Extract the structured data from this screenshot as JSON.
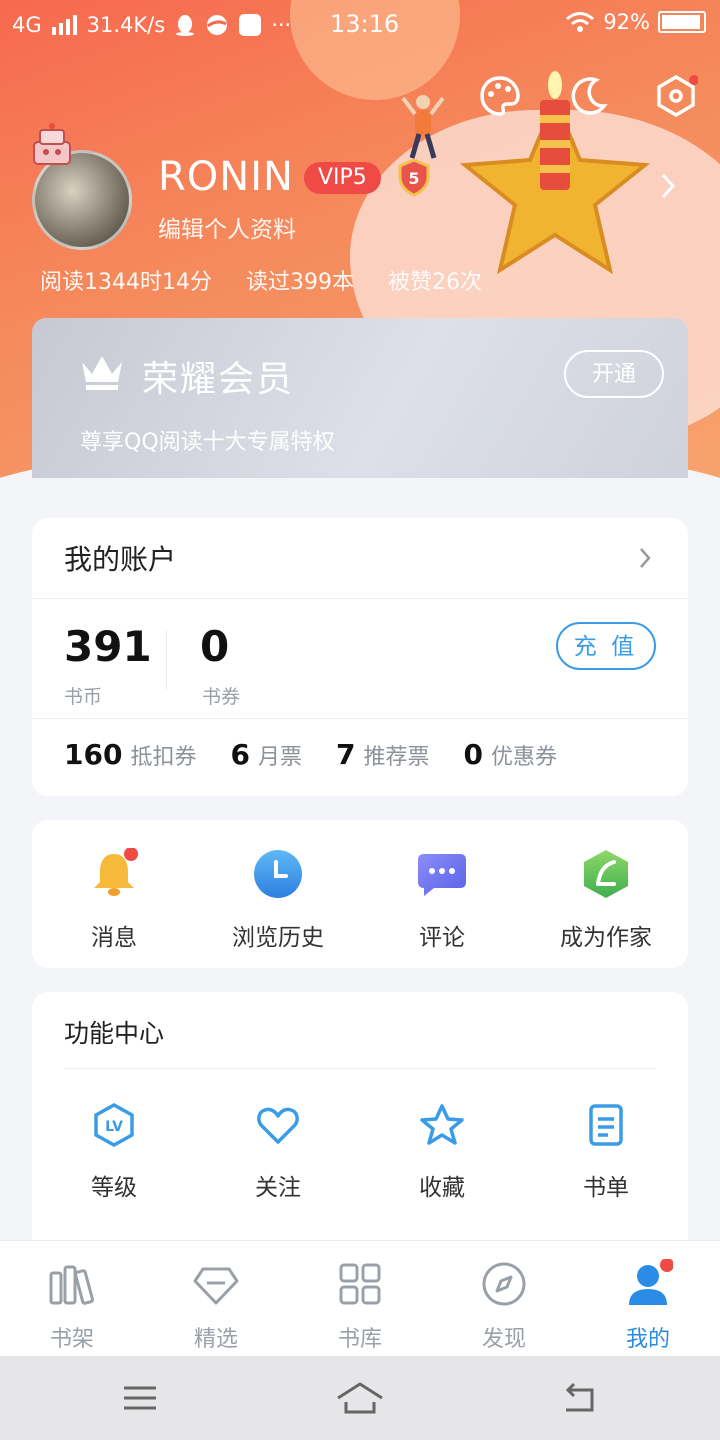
{
  "status_bar": {
    "network": "4G",
    "speed": "31.4K/s",
    "more": "···",
    "time": "13:16",
    "battery": "92%"
  },
  "profile": {
    "username": "RONIN",
    "vip_badge": "VIP5",
    "level_shield": "5",
    "edit_link": "编辑个人资料",
    "stats": [
      "阅读1344时14分",
      "读过399本",
      "被赞26次"
    ]
  },
  "member": {
    "title": "荣耀会员",
    "description": "尊享QQ阅读十大专属特权",
    "open_button": "开通"
  },
  "account": {
    "title": "我的账户",
    "coins_value": "391",
    "coins_label": "书币",
    "vouchers_value": "0",
    "vouchers_label": "书券",
    "recharge_button": "充 值",
    "mini": [
      {
        "value": "160",
        "label": "抵扣券"
      },
      {
        "value": "6",
        "label": "月票"
      },
      {
        "value": "7",
        "label": "推荐票"
      },
      {
        "value": "0",
        "label": "优惠券"
      }
    ]
  },
  "quick_actions": [
    {
      "label": "消息",
      "icon": "bell-icon"
    },
    {
      "label": "浏览历史",
      "icon": "clock-icon"
    },
    {
      "label": "评论",
      "icon": "comment-icon"
    },
    {
      "label": "成为作家",
      "icon": "feather-icon"
    }
  ],
  "function_center": {
    "title": "功能中心",
    "items": [
      {
        "label": "等级",
        "icon": "level-icon"
      },
      {
        "label": "关注",
        "icon": "heart-icon"
      },
      {
        "label": "收藏",
        "icon": "star-icon"
      },
      {
        "label": "书单",
        "icon": "booklist-icon"
      }
    ]
  },
  "tabs": [
    {
      "label": "书架",
      "icon": "bookshelf-icon"
    },
    {
      "label": "精选",
      "icon": "diamond-icon"
    },
    {
      "label": "书库",
      "icon": "grid-icon"
    },
    {
      "label": "发现",
      "icon": "compass-icon"
    },
    {
      "label": "我的",
      "icon": "user-icon",
      "active": true
    }
  ],
  "colors": {
    "accent": "#2b8ce6",
    "header": "#f7694e",
    "vip_red": "#ef4a46",
    "notify_dot": "#f04a45"
  }
}
